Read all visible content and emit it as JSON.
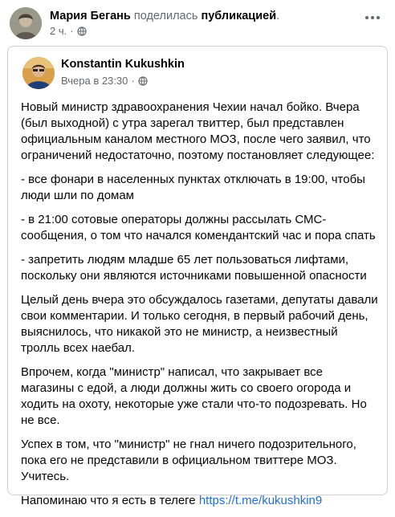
{
  "outer_post": {
    "author": "Мария Бегань",
    "action": "поделилась",
    "action_object": "публикацией",
    "trailing": ".",
    "time": "2 ч.",
    "separator": "·",
    "audience_icon": "globe-icon",
    "menu_icon": "more-options-icon"
  },
  "shared_post": {
    "author": "Konstantin Kukushkin",
    "time": "Вчера в 23:30",
    "separator": "·",
    "audience_icon": "globe-icon",
    "paragraphs": [
      "Новый министр здравоохранения Чехии начал бойко. Вчера (был выходной) с утра зарегал твиттер, был представлен официальным каналом местного МОЗ, после чего заявил, что ограничений недостаточно, поэтому постановляет следующее:",
      "- все фонари в населенных пунктах отключать в 19:00, чтобы люди шли по домам",
      "- в 21:00 сотовые операторы должны рассылать СМС-сообщения, о том что начался комендантский час и пора спать",
      "- запретить людям младше 65 лет пользоваться лифтами, поскольку они являются источниками повышенной опасности",
      "Целый день вчера это обсуждалось газетами, депутаты давали свои комментарии. И только сегодня, в первый рабочий день, выяснилось, что никакой это не министр, а неизвестный тролль всех наебал.",
      "Впрочем, когда \"министр\" написал, что закрывает все магазины с едой, а люди должны жить со своего огорода и ходить на охоту, некоторые уже стали что-то подозревать. Но не все.",
      "Успех в том, что \"министр\" не гнал ничего подозрительного, пока его не представили в официальном твиттере МОЗ. Учитесь."
    ],
    "last_line_text": "Напоминаю что я есть в телеге ",
    "last_line_link": "https://t.me/kukushkin9"
  }
}
